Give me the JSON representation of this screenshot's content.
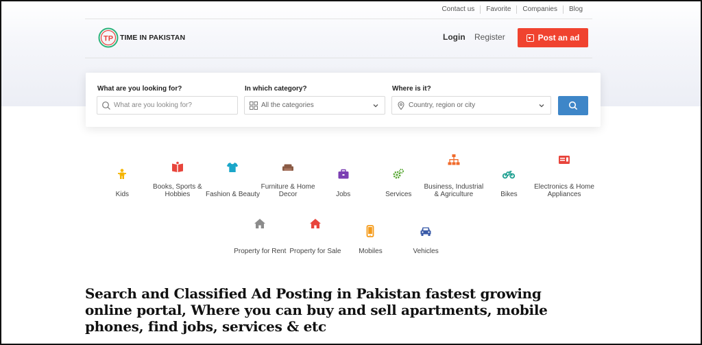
{
  "topbar": {
    "links": [
      "Contact us",
      "Favorite",
      "Companies",
      "Blog"
    ]
  },
  "header": {
    "logo_text": "TIME IN PAKISTAN",
    "login_label": "Login",
    "register_label": "Register",
    "post_ad_label": "Post an ad"
  },
  "search": {
    "what_label": "What are you looking for?",
    "what_placeholder": "What are you looking for?",
    "category_label": "In which category?",
    "category_value": "All the categories",
    "where_label": "Where is it?",
    "where_value": "Country, region or city"
  },
  "categories_row1": [
    {
      "label": "Kids",
      "icon": "kids-icon",
      "color": "#f5b400"
    },
    {
      "label": "Books, Sports & Hobbies",
      "icon": "book-icon",
      "color": "#e8453c"
    },
    {
      "label": "Fashion & Beauty",
      "icon": "tshirt-icon",
      "color": "#1aa6c9"
    },
    {
      "label": "Furniture & Home Decor",
      "icon": "sofa-icon",
      "color": "#8a5a44"
    },
    {
      "label": "Jobs",
      "icon": "briefcase-icon",
      "color": "#7b3fb3"
    },
    {
      "label": "Services",
      "icon": "gears-icon",
      "color": "#55a630"
    },
    {
      "label": "Business, Industrial & Agriculture",
      "icon": "sitemap-icon",
      "color": "#f06a2a"
    },
    {
      "label": "Bikes",
      "icon": "motorcycle-icon",
      "color": "#1a9e8f"
    },
    {
      "label": "Electronics & Home Appliances",
      "icon": "appliance-icon",
      "color": "#e8453c"
    }
  ],
  "categories_row2": [
    {
      "label": "Property for Rent",
      "icon": "house-icon",
      "color": "#8c8c8c"
    },
    {
      "label": "Property for Sale",
      "icon": "house-icon",
      "color": "#e8453c"
    },
    {
      "label": "Mobiles",
      "icon": "mobile-icon",
      "color": "#f59b1a"
    },
    {
      "label": "Vehicles",
      "icon": "car-icon",
      "color": "#3a5ba8"
    }
  ],
  "headline": "Search and Classified Ad Posting in Pakistan fastest growing online portal, Where you can buy and sell apartments, mobile phones, find jobs, services & etc",
  "colors": {
    "accent_red": "#f0432f",
    "search_blue": "#3e86c8"
  }
}
